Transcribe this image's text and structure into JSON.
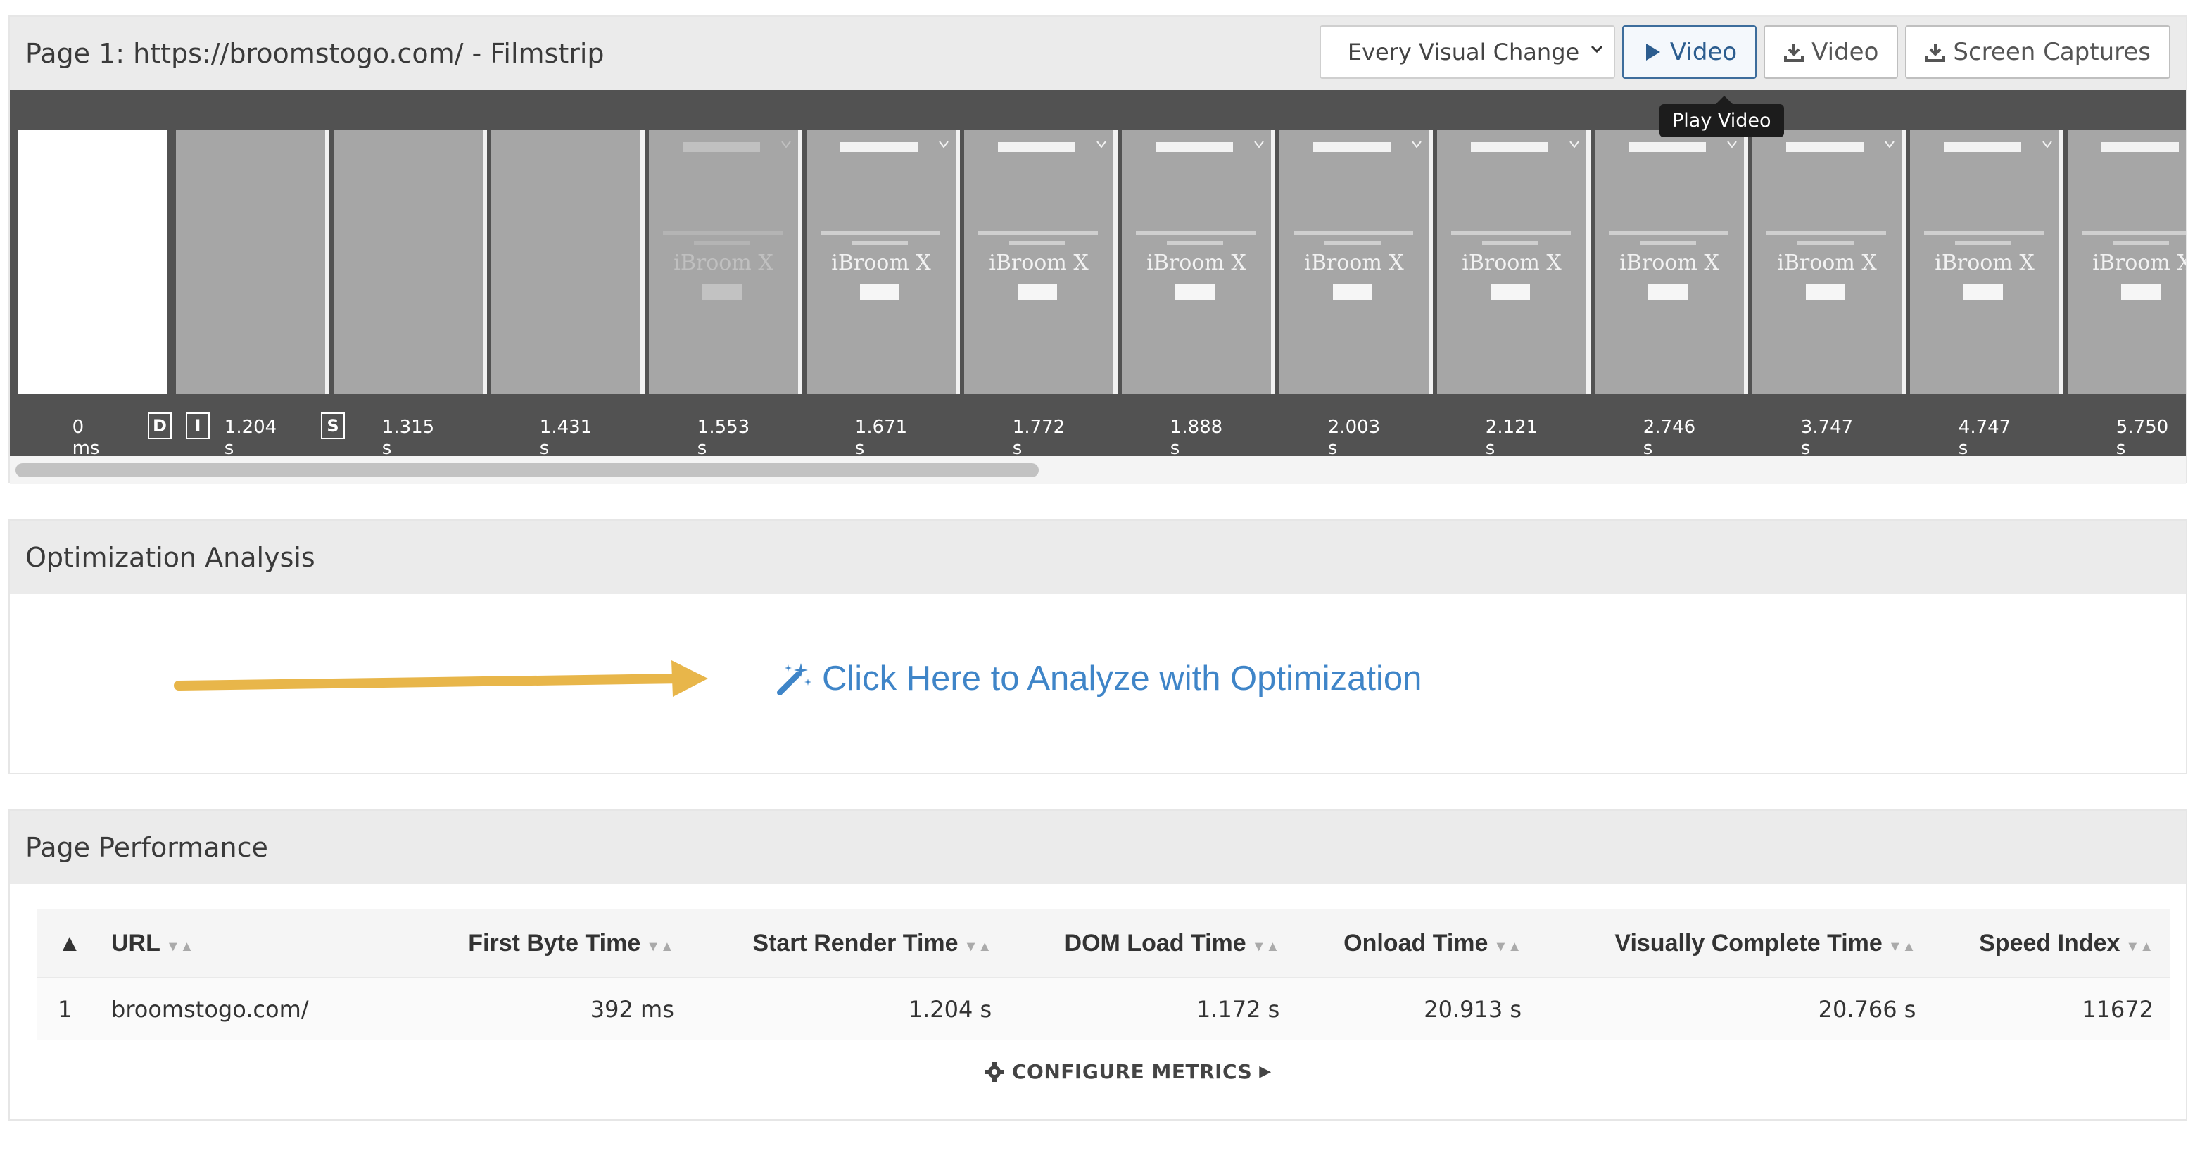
{
  "filmstrip": {
    "title": "Page 1: https://broomstogo.com/ - Filmstrip",
    "select_value": "Every Visual Change",
    "buttons": {
      "play_video": "Video",
      "download_video": "Video",
      "screen_captures": "Screen Captures"
    },
    "tooltip": "Play Video",
    "frame_brand_text": "iBroom X",
    "frames": [
      {
        "time": "0 ms"
      },
      {
        "time": "1.204 s"
      },
      {
        "time": "1.315 s"
      },
      {
        "time": "1.431 s"
      },
      {
        "time": "1.553 s"
      },
      {
        "time": "1.671 s"
      },
      {
        "time": "1.772 s"
      },
      {
        "time": "1.888 s"
      },
      {
        "time": "2.003 s"
      },
      {
        "time": "2.121 s"
      },
      {
        "time": "2.746 s"
      },
      {
        "time": "3.747 s"
      },
      {
        "time": "4.747 s"
      },
      {
        "time": "5.750 s"
      }
    ],
    "markers": [
      "D",
      "I",
      "S"
    ]
  },
  "optimization": {
    "title": "Optimization Analysis",
    "link_text": "Click Here to Analyze with Optimization",
    "arrow_color": "#e8b64a",
    "link_color": "#3f85c8"
  },
  "performance": {
    "title": "Page Performance",
    "columns": [
      "URL",
      "First Byte Time",
      "Start Render Time",
      "DOM Load Time",
      "Onload Time",
      "Visually Complete Time",
      "Speed Index"
    ],
    "rows": [
      {
        "index": "1",
        "url": "broomstogo.com/",
        "first_byte": "392 ms",
        "start_render": "1.204 s",
        "dom_load": "1.172 s",
        "onload": "20.913 s",
        "visually_complete": "20.766 s",
        "speed_index": "11672"
      }
    ],
    "configure_label": "CONFIGURE METRICS"
  }
}
